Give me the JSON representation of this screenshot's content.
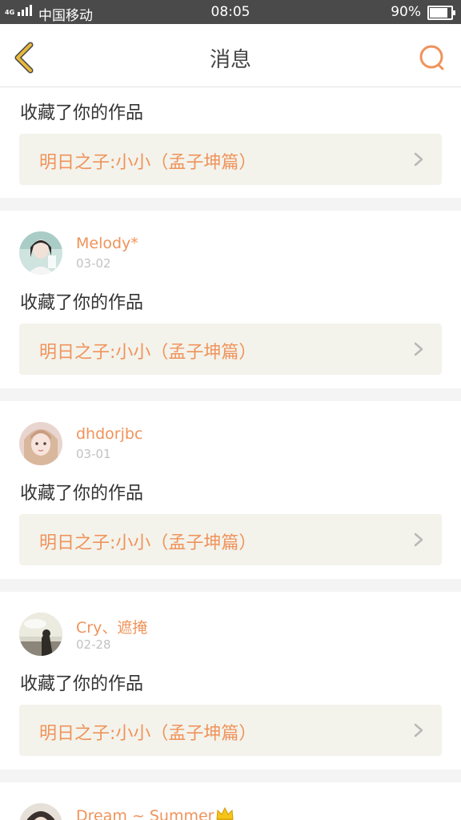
{
  "status_bar": {
    "network": "4G",
    "carrier": "中国移动",
    "time": "08:05",
    "battery": "90%"
  },
  "header": {
    "title": "消息",
    "back_icon": "chevron-left-icon",
    "search_icon": "search-icon"
  },
  "colors": {
    "accent": "#f0935a",
    "back_icon": "#e8b93a",
    "card_link_bg": "#f3f3ec"
  },
  "messages": [
    {
      "action": "收藏了你的作品",
      "work_title": "明日之子:小小（孟子坤篇）"
    },
    {
      "user": "Melody*",
      "date": "03-02",
      "action": "收藏了你的作品",
      "work_title": "明日之子:小小（孟子坤篇）"
    },
    {
      "user": "dhdorjbc",
      "date": "03-01",
      "action": "收藏了你的作品",
      "work_title": "明日之子:小小（孟子坤篇）"
    },
    {
      "user": "Cry、遮掩",
      "date": "02-28",
      "action": "收藏了你的作品",
      "work_title": "明日之子:小小（孟子坤篇）"
    },
    {
      "user": "Dream ~ Summer"
    }
  ]
}
